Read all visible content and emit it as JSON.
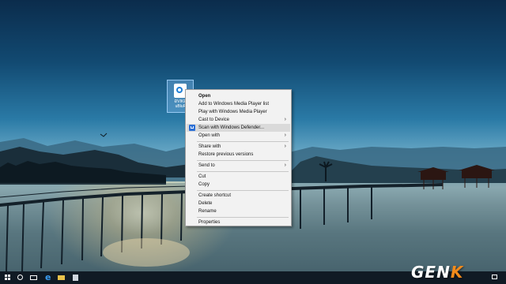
{
  "desktop": {
    "icon_label": "ĐVIKE-\nuBluRi"
  },
  "context_menu": {
    "items": [
      {
        "label": "Open",
        "bold": true
      },
      {
        "label": "Add to Windows Media Player list"
      },
      {
        "label": "Play with Windows Media Player"
      },
      {
        "label": "Cast to Device",
        "submenu": true
      },
      {
        "label": "Scan with Windows Defender...",
        "icon": "windows-defender-icon",
        "highlighted": true
      },
      {
        "label": "Open with",
        "submenu": true
      },
      {
        "label": "Share with",
        "submenu": true
      },
      {
        "label": "Restore previous versions"
      },
      {
        "label": "Send to",
        "submenu": true
      },
      {
        "label": "Cut"
      },
      {
        "label": "Copy"
      },
      {
        "label": "Create shortcut"
      },
      {
        "label": "Delete"
      },
      {
        "label": "Rename"
      },
      {
        "label": "Properties"
      }
    ]
  },
  "taskbar": {
    "icons": [
      "windows-start-icon",
      "cortana-search-icon",
      "task-view-icon",
      "edge-browser-icon",
      "file-explorer-icon",
      "store-icon",
      "action-center-icon"
    ]
  },
  "watermark": {
    "brand_main": "GEN",
    "brand_accent": "K"
  }
}
